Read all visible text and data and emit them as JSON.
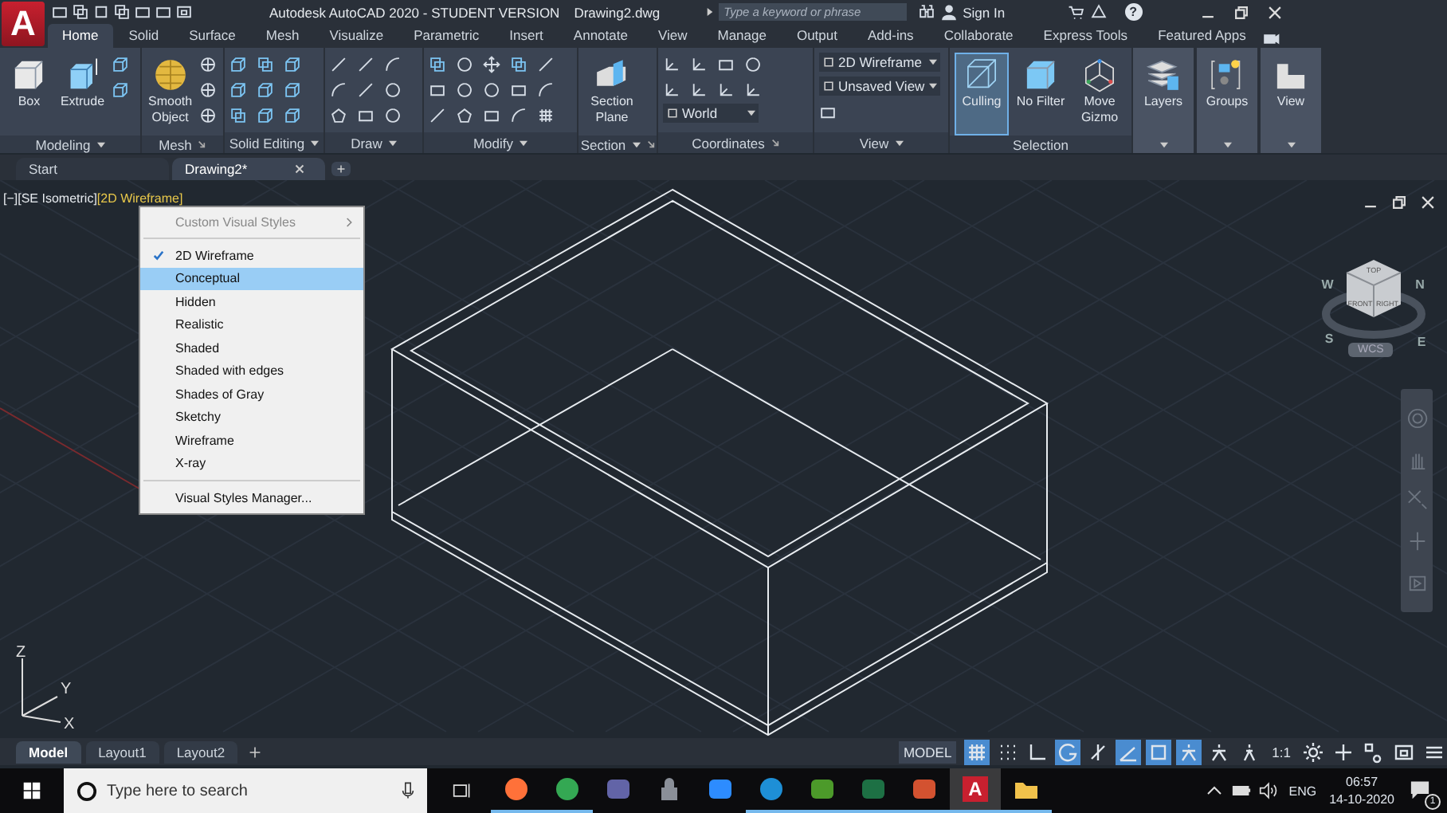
{
  "app_button": {
    "label": "A"
  },
  "title_bar": {
    "title": "Autodesk AutoCAD 2020 - STUDENT VERSION",
    "file": "Drawing2.dwg",
    "search": {
      "placeholder": "Type a keyword or phrase"
    },
    "sign_in": "Sign In",
    "help": "?"
  },
  "ribbon_tabs": [
    {
      "label": "Home",
      "selected": true
    },
    {
      "label": "Solid",
      "selected": false
    },
    {
      "label": "Surface",
      "selected": false
    },
    {
      "label": "Mesh",
      "selected": false
    },
    {
      "label": "Visualize",
      "selected": false
    },
    {
      "label": "Parametric",
      "selected": false
    },
    {
      "label": "Insert",
      "selected": false
    },
    {
      "label": "Annotate",
      "selected": false
    },
    {
      "label": "View",
      "selected": false
    },
    {
      "label": "Manage",
      "selected": false
    },
    {
      "label": "Output",
      "selected": false
    },
    {
      "label": "Add-ins",
      "selected": false
    },
    {
      "label": "Collaborate",
      "selected": false
    },
    {
      "label": "Express Tools",
      "selected": false
    },
    {
      "label": "Featured Apps",
      "selected": false
    }
  ],
  "ribbon_panels": [
    {
      "title": "Modeling",
      "kind": "modeling",
      "menu": true,
      "launcher": false,
      "buttons": [
        {
          "label": "Box",
          "kind": "box",
          "on": false
        },
        {
          "label": "Extrude",
          "kind": "extrude",
          "on": false
        }
      ]
    },
    {
      "title": "Mesh",
      "kind": "mesh",
      "menu": false,
      "launcher": true,
      "buttons": [
        {
          "label": "Smooth Object",
          "kind": "sphere",
          "on": false
        }
      ]
    },
    {
      "title": "Solid Editing",
      "kind": "solid",
      "menu": true,
      "launcher": false
    },
    {
      "title": "Draw",
      "kind": "draw",
      "menu": true,
      "launcher": false
    },
    {
      "title": "Modify",
      "kind": "modify",
      "menu": true,
      "launcher": false
    },
    {
      "title": "Section",
      "kind": "section",
      "menu": true,
      "launcher": true,
      "buttons": [
        {
          "label": "Section Plane",
          "kind": "plane",
          "on": false
        }
      ]
    },
    {
      "title": "Coordinates",
      "kind": "coordinates",
      "menu": false,
      "launcher": true,
      "dropdowns": [
        {
          "value": "World"
        }
      ]
    },
    {
      "title": "View",
      "kind": "view",
      "menu": true,
      "launcher": false,
      "dropdowns": [
        {
          "value": "2D Wireframe"
        },
        {
          "value": "Unsaved View"
        }
      ]
    },
    {
      "title": "Selection",
      "kind": "selection",
      "menu": false,
      "launcher": false,
      "buttons": [
        {
          "label": "Culling",
          "kind": "culling",
          "on": true
        },
        {
          "label": "No Filter",
          "kind": "filter",
          "on": false
        },
        {
          "label": "Move Gizmo",
          "kind": "gizmo",
          "on": false
        }
      ]
    },
    {
      "kind": "layers",
      "menu": true,
      "launcher": false,
      "buttons": [
        {
          "label": "Layers",
          "kind": "layers",
          "on": false
        }
      ]
    },
    {
      "kind": "groups",
      "menu": true,
      "launcher": false,
      "buttons": [
        {
          "label": "Groups",
          "kind": "groups",
          "on": false
        }
      ]
    },
    {
      "kind": "viewtools",
      "menu": true,
      "launcher": false,
      "buttons": [
        {
          "label": "View",
          "kind": "viewbtn",
          "on": false
        }
      ]
    }
  ],
  "file_tabs": [
    {
      "label": "Start",
      "selected": false,
      "closable": false
    },
    {
      "label": "Drawing2*",
      "selected": true,
      "closable": true
    }
  ],
  "viewport_label": {
    "controls": "[−]",
    "view": "[SE Isometric]",
    "style": "[2D Wireframe]"
  },
  "visual_styles_menu": {
    "header": "Custom Visual Styles",
    "items": [
      {
        "label": "2D Wireframe",
        "checked": true,
        "selected": false
      },
      {
        "label": "Conceptual",
        "checked": false,
        "selected": true
      },
      {
        "label": "Hidden",
        "checked": false,
        "selected": false
      },
      {
        "label": "Realistic",
        "checked": false,
        "selected": false
      },
      {
        "label": "Shaded",
        "checked": false,
        "selected": false
      },
      {
        "label": "Shaded with edges",
        "checked": false,
        "selected": false
      },
      {
        "label": "Shades of Gray",
        "checked": false,
        "selected": false
      },
      {
        "label": "Sketchy",
        "checked": false,
        "selected": false
      },
      {
        "label": "Wireframe",
        "checked": false,
        "selected": false
      },
      {
        "label": "X-ray",
        "checked": false,
        "selected": false
      }
    ],
    "footer": "Visual Styles Manager..."
  },
  "viewcube": {
    "faces": [
      "TOP",
      "FRONT",
      "RIGHT"
    ],
    "compass": {
      "north": "N",
      "east": "E",
      "south": "S",
      "west": "W"
    },
    "ucs": "WCS"
  },
  "ucs_icon": {
    "x": "X",
    "y": "Y",
    "z": "Z"
  },
  "layout_tabs": [
    {
      "label": "Model",
      "selected": true
    },
    {
      "label": "Layout1",
      "selected": false
    },
    {
      "label": "Layout2",
      "selected": false
    }
  ],
  "status_bar": {
    "space": "MODEL",
    "scale": "1:1",
    "toggles": [
      {
        "kind": "grid",
        "on": true
      },
      {
        "kind": "snap",
        "on": false
      },
      {
        "kind": "ortho",
        "on": false
      },
      {
        "kind": "polar",
        "on": true
      },
      {
        "kind": "tracking",
        "on": false
      },
      {
        "kind": "isodraft",
        "on": true
      },
      {
        "kind": "osnap",
        "on": true
      },
      {
        "kind": "annotation",
        "on": true
      },
      {
        "kind": "annoauto",
        "on": false
      },
      {
        "kind": "annoscale",
        "on": false
      }
    ]
  },
  "taskbar": {
    "search": {
      "placeholder": "Type here to search"
    },
    "apps": [
      {
        "kind": "firefox",
        "running": true,
        "active": false
      },
      {
        "kind": "chrome",
        "running": true,
        "active": false
      },
      {
        "kind": "teams",
        "running": false,
        "active": false
      },
      {
        "kind": "vpn",
        "running": false,
        "active": false
      },
      {
        "kind": "zoom",
        "running": false,
        "active": false
      },
      {
        "kind": "edge",
        "running": true,
        "active": false
      },
      {
        "kind": "project",
        "running": true,
        "active": false
      },
      {
        "kind": "excel",
        "running": true,
        "active": false
      },
      {
        "kind": "powerpoint",
        "running": true,
        "active": false
      },
      {
        "kind": "autocad",
        "label": "A",
        "running": true,
        "active": true
      },
      {
        "kind": "explorer",
        "running": true,
        "active": false
      }
    ],
    "language": "ENG",
    "time": "06:57",
    "date": "14-10-2020",
    "notifications": "1"
  }
}
